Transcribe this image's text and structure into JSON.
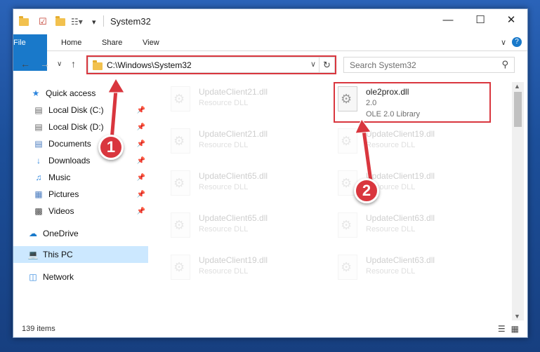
{
  "window": {
    "title": "System32",
    "minimize_icon": "minimize-icon",
    "maximize_icon": "maximize-icon",
    "close_icon": "close-icon"
  },
  "ribbon": {
    "tabs": [
      {
        "label": "File"
      },
      {
        "label": "Home"
      },
      {
        "label": "Share"
      },
      {
        "label": "View"
      }
    ]
  },
  "address": {
    "path": "C:\\Windows\\System32",
    "search_placeholder": "Search System32"
  },
  "sidebar": {
    "items": [
      {
        "label": "Quick access",
        "icon": "star-icon",
        "pinned": false
      },
      {
        "label": "Local Disk (C:)",
        "icon": "drive-icon",
        "pinned": true
      },
      {
        "label": "Local Disk (D:)",
        "icon": "drive-icon",
        "pinned": true
      },
      {
        "label": "Documents",
        "icon": "document-icon",
        "pinned": true
      },
      {
        "label": "Downloads",
        "icon": "download-icon",
        "pinned": true
      },
      {
        "label": "Music",
        "icon": "music-icon",
        "pinned": true
      },
      {
        "label": "Pictures",
        "icon": "pictures-icon",
        "pinned": true
      },
      {
        "label": "Videos",
        "icon": "video-icon",
        "pinned": true
      },
      {
        "label": "OneDrive",
        "icon": "cloud-icon",
        "pinned": false
      },
      {
        "label": "This PC",
        "icon": "computer-icon",
        "pinned": false,
        "selected": true
      },
      {
        "label": "Network",
        "icon": "network-icon",
        "pinned": false
      }
    ]
  },
  "files": {
    "left": [
      {
        "name": "UpdateClient21.dll",
        "type": "Resource DLL"
      },
      {
        "name": "UpdateClient21.dll",
        "type": "Resource DLL"
      },
      {
        "name": "UpdateClient65.dll",
        "type": "Resource DLL"
      },
      {
        "name": "UpdateClient65.dll",
        "type": "Resource DLL"
      },
      {
        "name": "UpdateClient19.dll",
        "type": "Resource DLL"
      }
    ],
    "right": [
      {
        "name": "ole2prox.dll",
        "version": "2.0",
        "type": "OLE 2.0 Library",
        "highlighted": true
      },
      {
        "name": "UpdateClient19.dll",
        "type": "Resource DLL"
      },
      {
        "name": "UpdateClient19.dll",
        "type": "Resource DLL"
      },
      {
        "name": "UpdateClient63.dll",
        "type": "Resource DLL"
      },
      {
        "name": "UpdateClient63.dll",
        "type": "Resource DLL"
      }
    ]
  },
  "status": {
    "item_count": "139 items"
  },
  "annotations": {
    "step1": "1",
    "step2": "2",
    "color": "#d9363e"
  }
}
